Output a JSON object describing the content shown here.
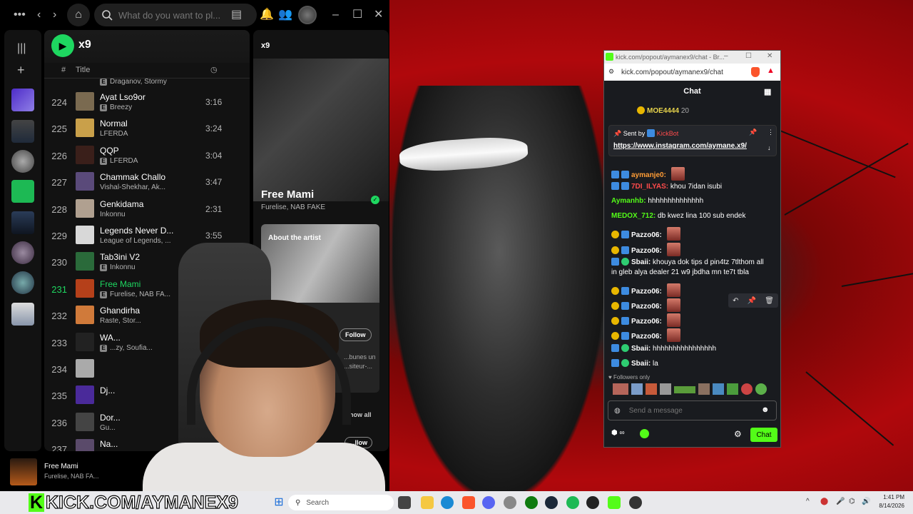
{
  "spotify": {
    "search_placeholder": "What do you want to pl...",
    "playlist_name": "x9",
    "col_number": "#",
    "col_title": "Title",
    "partial_top_artist": "Draganov, Stormy",
    "tracks": [
      {
        "num": "224",
        "title": "Ayat Lso9or",
        "artist": "Breezy",
        "explicit": true,
        "duration": "3:16"
      },
      {
        "num": "225",
        "title": "Normal",
        "artist": "LFERDA",
        "explicit": false,
        "duration": "3:24"
      },
      {
        "num": "226",
        "title": "QQP",
        "artist": "LFERDA",
        "explicit": true,
        "duration": "3:04"
      },
      {
        "num": "227",
        "title": "Chammak Challo",
        "artist": "Vishal-Shekhar, Ak...",
        "explicit": false,
        "duration": "3:47"
      },
      {
        "num": "228",
        "title": "Genkidama",
        "artist": "Inkonnu",
        "explicit": false,
        "duration": "2:31"
      },
      {
        "num": "229",
        "title": "Legends Never D...",
        "artist": "League of Legends, ...",
        "explicit": false,
        "duration": "3:55"
      },
      {
        "num": "230",
        "title": "Tab3ini V2",
        "artist": "Inkonnu",
        "explicit": true,
        "duration": ""
      },
      {
        "num": "231",
        "title": "Free Mami",
        "artist": "Furelise, NAB FA...",
        "explicit": true,
        "duration": "",
        "active": true
      },
      {
        "num": "232",
        "title": "Ghandirha",
        "artist": "Raste, Stor...",
        "explicit": false,
        "duration": ""
      },
      {
        "num": "233",
        "title": "WA...",
        "artist": "...zy, Soufia...",
        "explicit": true,
        "duration": ""
      },
      {
        "num": "234",
        "title": "",
        "artist": "",
        "explicit": false,
        "duration": ""
      },
      {
        "num": "235",
        "title": "Dj...",
        "artist": "",
        "explicit": false,
        "duration": ""
      },
      {
        "num": "236",
        "title": "Dor...",
        "artist": "Gu...",
        "explicit": false,
        "duration": ""
      },
      {
        "num": "237",
        "title": "Na...",
        "artist": "",
        "explicit": false,
        "duration": ""
      }
    ],
    "right_panel": {
      "header": "x9",
      "song_title": "Free Mami",
      "song_artists": "Furelise, NAB FAKE",
      "about_label": "About the artist",
      "follow_label": "Follow",
      "bio_fragment": "...bunes un ...siteur-...",
      "show_all": "Show all",
      "follow2": "...llow"
    },
    "now_playing": {
      "title": "Free Mami",
      "artist": "Furelise, NAB FA..."
    }
  },
  "chat": {
    "window_title": "kick.com/popout/aymanex9/chat - Br...",
    "url": "kick.com/popout/aymanex9/chat",
    "header": "Chat",
    "top_user": "MOE4444",
    "top_count": "20",
    "pinned_sent_by": "Sent by",
    "pinned_bot": "KickBot",
    "pinned_link": "https://www.instagram.com/aymane.x9/",
    "messages": [
      {
        "user": "aymanje0:",
        "text": "",
        "color": "#ff9d36",
        "emote": true
      },
      {
        "user": "7DI_ILYAS:",
        "text": "khou 7idan isubi",
        "color": "#ff4b4b"
      },
      {
        "user": "Aymanhb:",
        "text": "hhhhhhhhhhhhhh",
        "color": "#53fc18"
      },
      {
        "user": "MEDOX_712:",
        "text": "db kwez lina 100 sub endek",
        "color": "#53fc18"
      },
      {
        "user": "Pazzo06:",
        "text": "",
        "color": "#ffffff",
        "emote": true
      },
      {
        "user": "Pazzo06:",
        "text": "",
        "color": "#ffffff",
        "emote": true
      },
      {
        "user": "Sbaii:",
        "text": "khouya dok tips d pin4tz 7tlthom all",
        "color": "#ffffff"
      },
      {
        "user": "",
        "text": "in gleb alya dealer 21 w9 jbdha mn te7t tbla",
        "color": "#ffffff"
      },
      {
        "user": "Pazzo06:",
        "text": "",
        "color": "#ffffff",
        "emote": true
      },
      {
        "user": "Pazzo06:",
        "text": "",
        "color": "#ffffff",
        "emote": true
      },
      {
        "user": "Pazzo06:",
        "text": "",
        "color": "#ffffff",
        "emote": true
      },
      {
        "user": "Pazzo06:",
        "text": "",
        "color": "#ffffff",
        "emote": true
      },
      {
        "user": "Sbaii:",
        "text": "hhhhhhhhhhhhhhhh",
        "color": "#ffffff"
      },
      {
        "user": "Sbaii:",
        "text": "la",
        "color": "#ffffff"
      }
    ],
    "followers_only": "Followers only",
    "send_placeholder": "Send a message",
    "chat_button": "Chat",
    "accent": "#53fc18"
  },
  "overlay_banner": "KICK.COM/AYMANEX9",
  "taskbar": {
    "search_placeholder": "Search",
    "time": "1:41 PM",
    "date": "8/14/2026"
  }
}
